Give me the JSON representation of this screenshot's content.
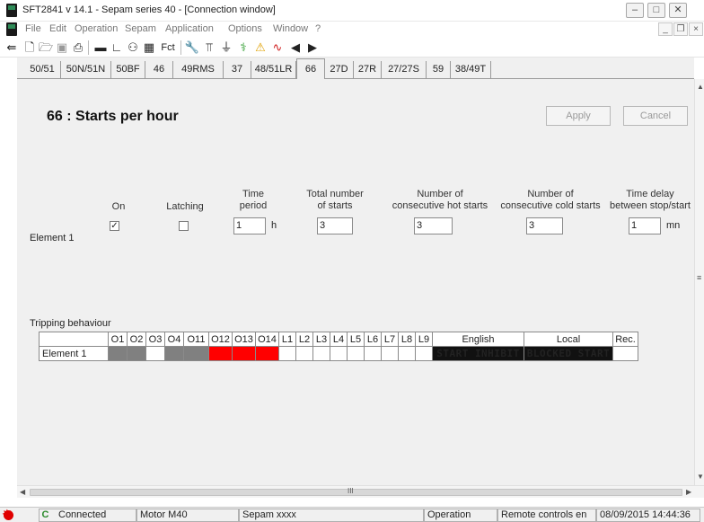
{
  "window": {
    "title": "SFT2841  v 14.1 - Sepam series 40 - [Connection window]",
    "minimize": "–",
    "maximize": "□",
    "close": "✕",
    "mdi_minimize": "_",
    "mdi_restore": "❐",
    "mdi_close": "×"
  },
  "menu": [
    "File",
    "Edit",
    "Operation",
    "Sepam",
    "Application",
    "Options",
    "Window",
    "?"
  ],
  "toolbar": {
    "fct_label": "Fct"
  },
  "tabs": [
    "50/51",
    "50N/51N",
    "50BF",
    "46",
    "49RMS",
    "37",
    "48/51LR",
    "66",
    "27D",
    "27R",
    "27/27S",
    "59",
    "38/49T"
  ],
  "active_tab": "66",
  "page": {
    "title": "66 : Starts per hour",
    "apply_label": "Apply",
    "cancel_label": "Cancel"
  },
  "columns": {
    "on": "On",
    "latching": "Latching",
    "time_period": [
      "Time",
      "period"
    ],
    "total_starts": [
      "Total number",
      "of starts"
    ],
    "hot_starts": [
      "Number of",
      "consecutive hot starts"
    ],
    "cold_starts": [
      "Number of",
      "consecutive cold starts"
    ],
    "time_delay": [
      "Time delay",
      "between stop/start"
    ]
  },
  "element1": {
    "label": "Element 1",
    "on_checked": true,
    "latching_checked": false,
    "time_period": "1",
    "time_period_unit": "h",
    "total_starts": "3",
    "hot_starts": "3",
    "cold_starts": "3",
    "time_delay": "1",
    "time_delay_unit": "mn"
  },
  "tripping": {
    "title": "Tripping behaviour",
    "columns": [
      "O1",
      "O2",
      "O3",
      "O4",
      "O11",
      "O12",
      "O13",
      "O14",
      "L1",
      "L2",
      "L3",
      "L4",
      "L5",
      "L6",
      "L7",
      "L8",
      "L9",
      "English",
      "Local",
      "Rec."
    ],
    "row_label": "Element 1",
    "english_text": "START INHIBIT",
    "local_text": "BLOCKED START",
    "colors": {
      "gray": "#808080",
      "red": "#ff0000"
    }
  },
  "scrollbar": {
    "h_middle": "III"
  },
  "status": {
    "connected": "Connected",
    "motor": "Motor M40",
    "sepam": "Sepam xxxx",
    "mode": "Operation",
    "remote": "Remote controls en",
    "datetime": "08/09/2015  14:44:36"
  }
}
